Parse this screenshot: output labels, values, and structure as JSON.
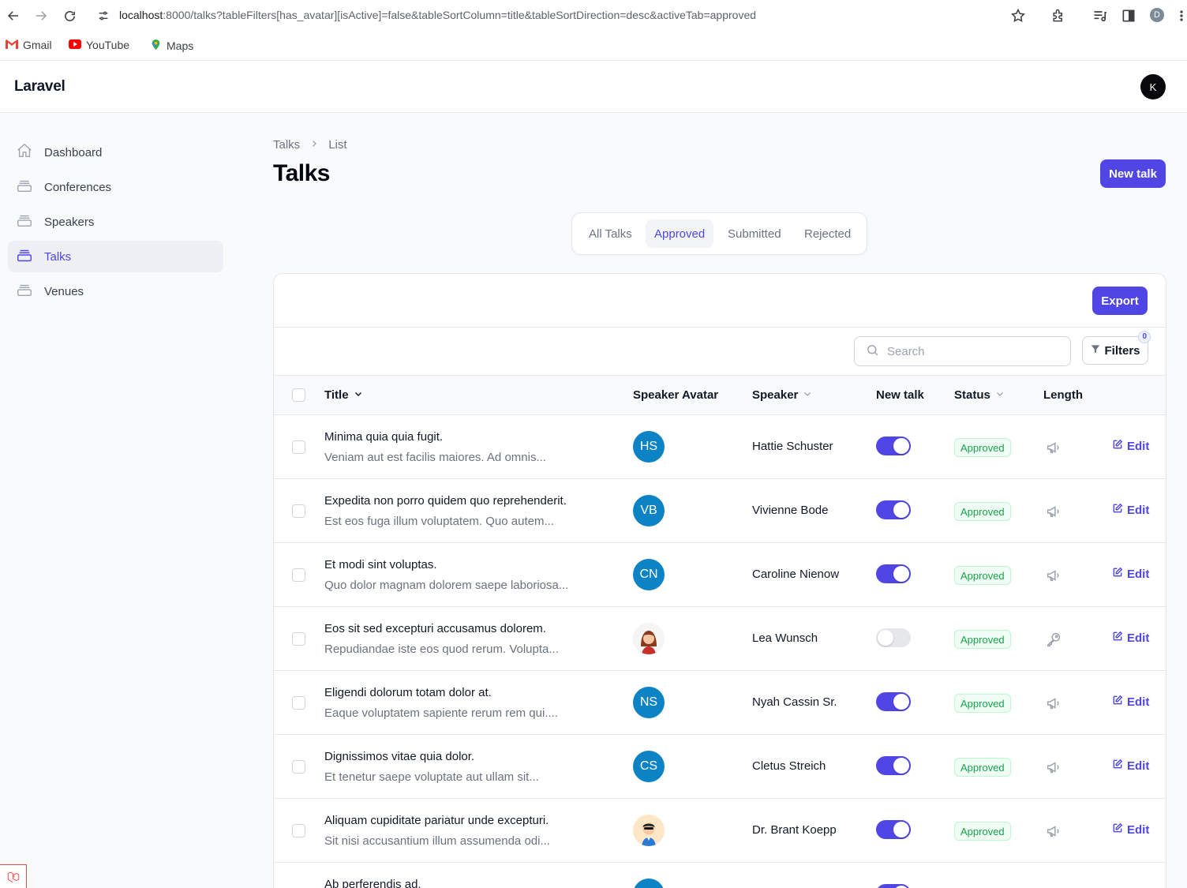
{
  "browser": {
    "url_host": "localhost",
    "url_rest": ":8000/talks?tableFilters[has_avatar][isActive]=false&tableSortColumn=title&tableSortDirection=desc&activeTab=approved",
    "profile_initial": "D",
    "bookmarks": [
      "Gmail",
      "YouTube",
      "Maps"
    ]
  },
  "app": {
    "brand": "Laravel",
    "user_initial": "K"
  },
  "sidebar": {
    "items": [
      {
        "label": "Dashboard",
        "icon": "home-icon"
      },
      {
        "label": "Conferences",
        "icon": "stack-icon"
      },
      {
        "label": "Speakers",
        "icon": "stack-icon"
      },
      {
        "label": "Talks",
        "icon": "stack-icon",
        "active": true
      },
      {
        "label": "Venues",
        "icon": "stack-icon"
      }
    ]
  },
  "page": {
    "breadcrumb": [
      "Talks",
      "List"
    ],
    "title": "Talks",
    "new_button": "New talk"
  },
  "tabs": [
    "All Talks",
    "Approved",
    "Submitted",
    "Rejected"
  ],
  "table": {
    "export_label": "Export",
    "search_placeholder": "Search",
    "filters_label": "Filters",
    "filters_count": "0",
    "columns": [
      "Title",
      "Speaker Avatar",
      "Speaker",
      "New talk",
      "Status",
      "Length"
    ],
    "edit_label": "Edit",
    "rows": [
      {
        "title": "Minima quia quia fugit.",
        "desc": "Veniam aut est facilis maiores. Ad omnis...",
        "initials": "HS",
        "speaker": "Hattie Schuster",
        "new_talk": true,
        "status": "Approved",
        "length_icon": "megaphone-icon"
      },
      {
        "title": "Expedita non porro quidem quo reprehenderit.",
        "desc": "Est eos fuga illum voluptatem. Quo autem...",
        "initials": "VB",
        "speaker": "Vivienne Bode",
        "new_talk": true,
        "status": "Approved",
        "length_icon": "megaphone-icon"
      },
      {
        "title": "Et modi sint voluptas.",
        "desc": "Quo dolor magnam dolorem saepe laboriosa...",
        "initials": "CN",
        "speaker": "Caroline Nienow",
        "new_talk": true,
        "status": "Approved",
        "length_icon": "megaphone-icon"
      },
      {
        "title": "Eos sit sed excepturi accusamus dolorem.",
        "desc": "Repudiandae iste eos quod rerum. Volupta...",
        "initials": "",
        "speaker": "Lea Wunsch",
        "new_talk": false,
        "status": "Approved",
        "length_icon": "key-icon"
      },
      {
        "title": "Eligendi dolorum totam dolor at.",
        "desc": "Eaque voluptatem sapiente rerum rem qui....",
        "initials": "NS",
        "speaker": "Nyah Cassin Sr.",
        "new_talk": true,
        "status": "Approved",
        "length_icon": "megaphone-icon"
      },
      {
        "title": "Dignissimos vitae quia dolor.",
        "desc": "Et tenetur saepe voluptate aut ullam sit...",
        "initials": "CS",
        "speaker": "Cletus Streich",
        "new_talk": true,
        "status": "Approved",
        "length_icon": "megaphone-icon"
      },
      {
        "title": "Aliquam cupiditate pariatur unde excepturi.",
        "desc": "Sit nisi accusantium illum assumenda odi...",
        "initials": "",
        "speaker": "Dr. Brant Koepp",
        "new_talk": true,
        "status": "Approved",
        "length_icon": "megaphone-icon"
      },
      {
        "title": "Ab perferendis ad.",
        "desc": "",
        "initials": "",
        "speaker": "",
        "new_talk": true,
        "status": "",
        "length_icon": "megaphone-icon"
      }
    ]
  },
  "colors": {
    "primary": "#4f46e5",
    "avatar_bg": "#0c83c4",
    "approved": "#16a34a"
  }
}
